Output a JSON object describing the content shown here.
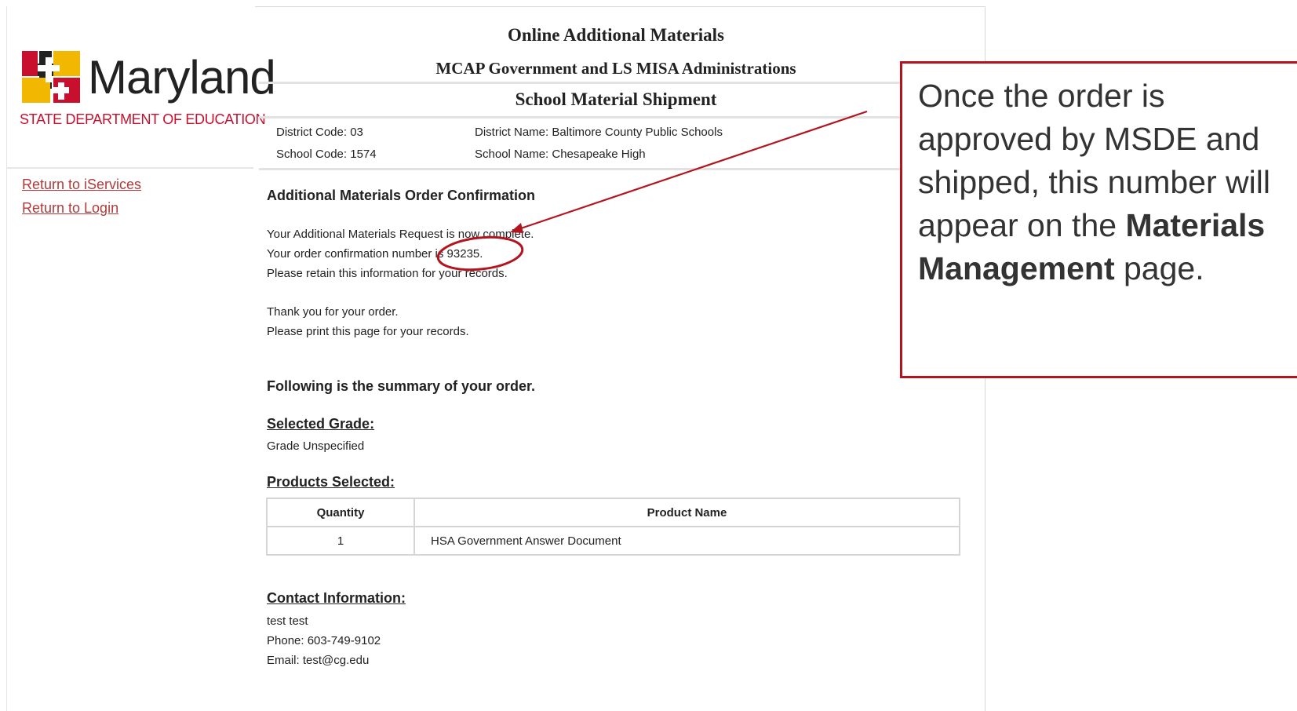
{
  "logo": {
    "wordmark": "Maryland",
    "subtitle": "STATE DEPARTMENT OF EDUCATION",
    "colors": {
      "red": "#c8102e",
      "gold": "#f2b700",
      "black": "#222222"
    }
  },
  "sidebar": {
    "links": [
      {
        "label": "Return to iServices"
      },
      {
        "label": "Return to Login"
      }
    ],
    "link_color": "#b23a3a"
  },
  "header": {
    "title": "Online Additional Materials",
    "subtitle": "MCAP Government and LS MISA Administrations",
    "section": "School Material Shipment"
  },
  "school_info": {
    "district_code": "District Code: 03",
    "district_name": "District Name: Baltimore County Public Schools",
    "school_code": "School Code: 1574",
    "school_name": "School Name: Chesapeake High"
  },
  "confirmation": {
    "heading": "Additional Materials Order Confirmation",
    "line1": "Your Additional Materials Request is now complete.",
    "line2": "Your order confirmation number is 93235.",
    "line3": "Please retain this information for your records.",
    "thanks": "Thank you for your order.",
    "print_note": "Please print this page for your records."
  },
  "summary": {
    "heading": "Following is the summary of your order.",
    "grade_heading": "Selected Grade:",
    "grade_value": "Grade Unspecified",
    "products_heading": "Products Selected:",
    "products_table": {
      "columns": [
        "Quantity",
        "Product Name"
      ],
      "rows": [
        {
          "quantity": "1",
          "product_name": "HSA Government Answer Document"
        }
      ]
    },
    "contact_heading": "Contact Information:",
    "contact_name": "test test",
    "contact_phone": "Phone: 603-749-9102",
    "contact_email": "Email: test@cg.edu"
  },
  "callout": {
    "text_before": "Once the order is approved by MSDE and shipped, this number will appear on the ",
    "bold_text": "Materials Management",
    "text_after": " page.",
    "border_color": "#b3141e"
  },
  "annotation_color": "#b3141e"
}
